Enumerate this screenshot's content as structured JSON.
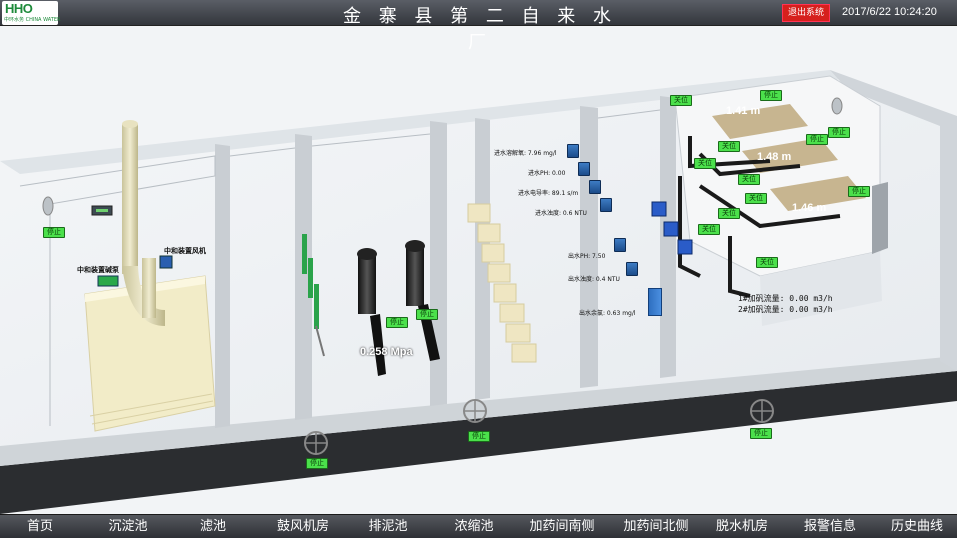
{
  "header": {
    "logo_main": "HHO",
    "logo_sub": "中环水务 CHINA WATER",
    "title": "金 寨 县 第 二 自 来 水 厂",
    "logout_label": "退出系统",
    "datetime": "2017/6/22 10:24:20"
  },
  "scene": {
    "neutralizer_fan_label": "中和装置风机",
    "neutralizer_pump_label": "中和装置碱泵",
    "pressure_reading": "0.258  Mpa",
    "inlet": {
      "dissolved_oxygen": "进水溶解氧:  7.96  mg/l",
      "ph": "进水PH:  0.00",
      "conductivity": "进水电导率:  89.1  s/m",
      "turbidity": "进水浊度:  0.6  NTU"
    },
    "outlet": {
      "ph": "出水PH:  7.50",
      "turbidity": "出水浊度:  0.4  NTU",
      "residual_chlorine": "出水余氯:  0.63  mg/l"
    },
    "tank_levels": [
      "1.41  m",
      "1.48  m",
      "1.46  m"
    ],
    "flow_1": "1#加矾流量: 0.00 m3/h",
    "flow_2": "2#加矾流量: 0.00 m3/h",
    "status_stop": "停止",
    "status_closed": "关位"
  },
  "nav": {
    "items": [
      "首页",
      "沉淀池",
      "滤池",
      "鼓风机房",
      "排泥池",
      "浓缩池",
      "加药间南侧",
      "加药间北侧",
      "脱水机房",
      "报警信息",
      "历史曲线"
    ]
  },
  "colors": {
    "status_green": "#4be04b",
    "logout_red": "#d6201d",
    "sensor_blue": "#3d7cc4"
  }
}
